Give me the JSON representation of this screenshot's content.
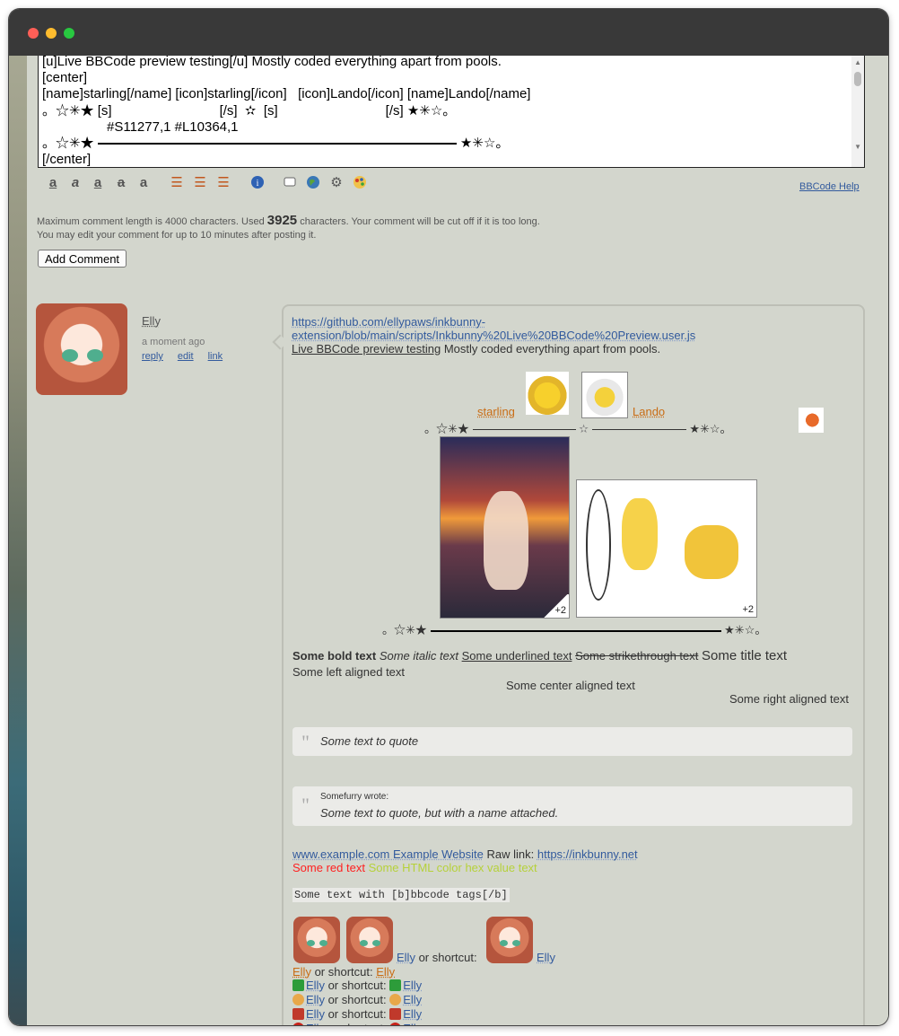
{
  "editor": {
    "line1": "[u]Live BBCode preview testing[/u] Mostly coded everything apart from pools.",
    "line2": "[center]",
    "line3": "[name]starling[/name] [icon]starling[/icon]   [icon]Lando[/icon] [name]Lando[/name]",
    "line4a": "。☆✳★ [s]",
    "line4b": "[/s]  ✫  [s]",
    "line4c": "[/s] ★✳☆。",
    "line5": "#S11277,1 #L10364,1",
    "line6a": "。☆✳★",
    "line6b": "★✳☆。",
    "line7": "[/center]"
  },
  "toolbar": {
    "icons": [
      "bold-icon",
      "italic-icon",
      "underline-icon",
      "strikethrough-icon",
      "title-icon",
      "align-left-icon",
      "align-center-icon",
      "align-right-icon",
      "info-icon",
      "quote-icon",
      "globe-icon",
      "gear-icon",
      "palette-icon"
    ],
    "help": "BBCode Help"
  },
  "notes": {
    "limit_a": "Maximum comment length is 4000 characters. Used ",
    "limit_count": "3925",
    "limit_b": " characters. Your comment will be cut off if it is too long.",
    "edit": "You may edit your comment for up to 10 minutes after posting it."
  },
  "add_comment": "Add Comment",
  "comment": {
    "author": "Elly",
    "time": "a moment ago",
    "reply": "reply",
    "edit": "edit",
    "link": "link"
  },
  "preview": {
    "url1": "https://github.com/ellypaws/inkbunny-",
    "url2": "extension/blob/main/scripts/Inkbunny%20Live%20BBCode%20Preview.user.js",
    "title_u": "Live BBCode preview testing",
    "title_rest": " Mostly coded everything apart from pools.",
    "name1": "starling",
    "name2": "Lando",
    "stars_left": "。☆✳★",
    "stars_right": "★✳☆。",
    "star_mid": "✫",
    "plus1": "+2",
    "plus2": "+2",
    "bold": "Some bold text",
    "italic": "Some italic text",
    "underline": "Some underlined text",
    "strike": "Some strikethrough text",
    "title": "Some title text",
    "left": "Some left aligned text",
    "center": "Some center aligned text",
    "right": "Some right aligned text",
    "quote1": "Some text to quote",
    "quote2_name": "Somefurry wrote:",
    "quote2": "Some text to quote, but with a name attached.",
    "site_link": "www.example.com Example Website",
    "raw_label": " Raw link: ",
    "raw_link": "https://inkbunny.net",
    "red": "Some red text",
    "hex": "Some HTML color hex value text",
    "code": "Some text with [b]bbcode tags[/b]",
    "elly": "Elly",
    "or_shortcut": " or shortcut: ",
    "colors": {
      "red": "#ff1f1f",
      "hex": "#b6d13a",
      "link": "#325a9d",
      "name": "#c96c14"
    }
  }
}
